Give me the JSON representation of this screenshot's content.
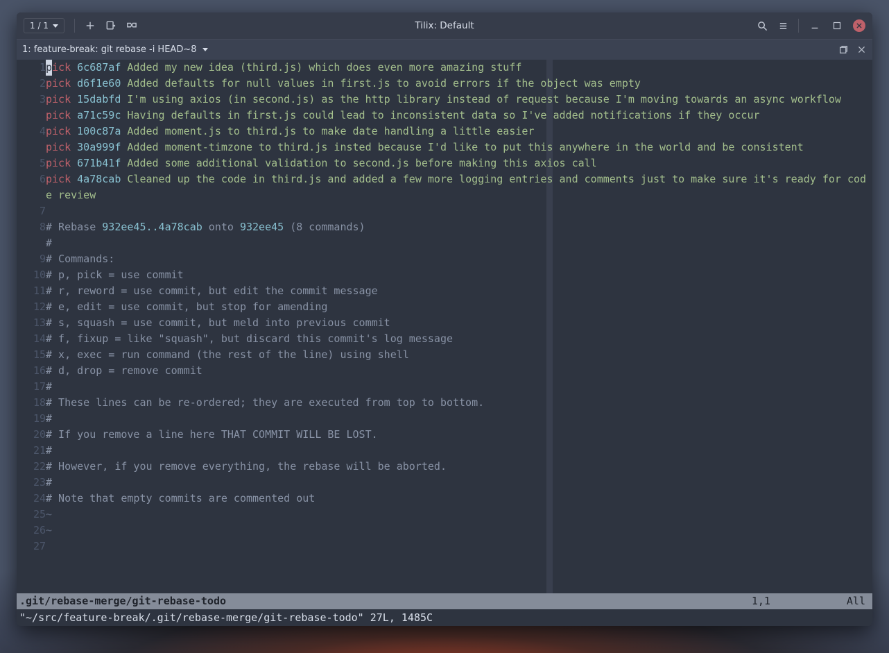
{
  "window": {
    "title": "Tilix: Default",
    "tab_counter": "1 / 1"
  },
  "terminal_tab": {
    "title": "1: feature-break: git rebase -i HEAD~8"
  },
  "commits": [
    {
      "cmd": "pick",
      "sha": "6c687af",
      "msg": "Added my new idea (third.js) which does even more amazing stuff"
    },
    {
      "cmd": "pick",
      "sha": "d6f1e60",
      "msg": "Added defaults for null values in first.js to avoid errors if the object was empty"
    },
    {
      "cmd": "pick",
      "sha": "15dabfd",
      "msg": "I'm using axios (in second.js) as the http library instead of request because I'm moving towards an async workflow"
    },
    {
      "cmd": "pick",
      "sha": "a71c59c",
      "msg": "Having defaults in first.js could lead to inconsistent data so I've added notifications if they occur"
    },
    {
      "cmd": "pick",
      "sha": "100c87a",
      "msg": "Added moment.js to third.js to make date handling a little easier"
    },
    {
      "cmd": "pick",
      "sha": "30a999f",
      "msg": "Added moment-timzone to third.js insted because I'd like to put this anywhere in the world and be consistent"
    },
    {
      "cmd": "pick",
      "sha": "671b41f",
      "msg": "Added some additional validation to second.js before making this axios call"
    },
    {
      "cmd": "pick",
      "sha": "4a78cab",
      "msg": "Cleaned up the code in third.js and added a few more logging entries and comments just to make sure it's ready for code review"
    }
  ],
  "rebase_header": {
    "prefix": "# Rebase ",
    "range": "932ee45..4a78cab",
    "onto_pre": " onto ",
    "onto": "932ee45",
    "suffix": " (8 commands)"
  },
  "comments": [
    "#",
    "# Commands:",
    "# p, pick = use commit",
    "# r, reword = use commit, but edit the commit message",
    "# e, edit = use commit, but stop for amending",
    "# s, squash = use commit, but meld into previous commit",
    "# f, fixup = like \"squash\", but discard this commit's log message",
    "# x, exec = run command (the rest of the line) using shell",
    "# d, drop = remove commit",
    "#",
    "# These lines can be re-ordered; they are executed from top to bottom.",
    "#",
    "# If you remove a line here THAT COMMIT WILL BE LOST.",
    "#",
    "# However, if you remove everything, the rebase will be aborted.",
    "#",
    "# Note that empty commits are commented out"
  ],
  "status": {
    "filename": ".git/rebase-merge/git-rebase-todo",
    "position": "1,1",
    "percent": "All"
  },
  "cmdline": "\"~/src/feature-break/.git/rebase-merge/git-rebase-todo\" 27L, 1485C"
}
